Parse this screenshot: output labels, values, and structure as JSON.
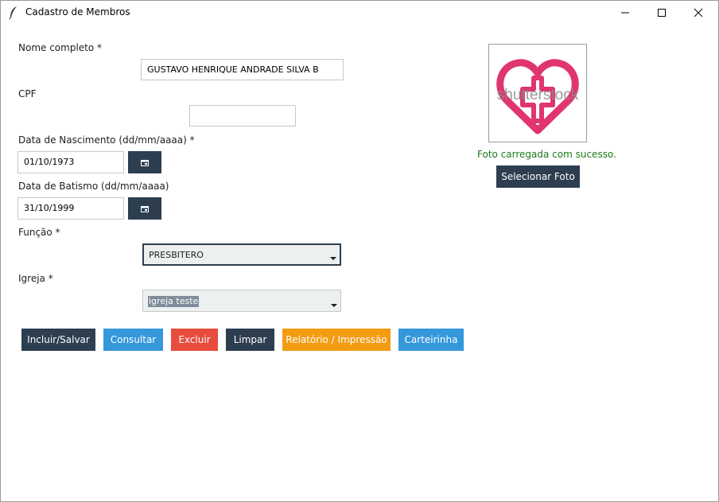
{
  "window": {
    "title": "Cadastro de Membros",
    "icon": "feather-icon",
    "controls": [
      "minimize-icon",
      "maximize-icon",
      "close-icon"
    ]
  },
  "form": {
    "nome": {
      "label": "Nome completo *",
      "value": "GUSTAVO HENRIQUE ANDRADE SILVA B"
    },
    "cpf": {
      "label": "CPF",
      "value": ""
    },
    "nascimento": {
      "label": "Data de Nascimento (dd/mm/aaaa) *",
      "value": "01/10/1973",
      "button_icon": "calendar-icon"
    },
    "batismo": {
      "label": "Data de Batismo (dd/mm/aaaa)",
      "value": "31/10/1999",
      "button_icon": "calendar-icon"
    },
    "funcao": {
      "label": "Função *",
      "value": "PRESBITERO"
    },
    "igreja": {
      "label": "Igreja *",
      "value": "igreja teste"
    }
  },
  "photo": {
    "image_icon": "heart-cross-logo",
    "watermark": "shutterstock",
    "status": "Foto carregada com sucesso.",
    "select_label": "Selecionar Foto"
  },
  "actions": {
    "save": "Incluir/Salvar",
    "query": "Consultar",
    "delete": "Excluir",
    "clear": "Limpar",
    "report": "Relatório / Impressão",
    "card": "Carteirinha"
  },
  "colors": {
    "dark": "#2c3e50",
    "blue": "#3498db",
    "red": "#e74c3c",
    "orange": "#f39c12",
    "logo": "#e0356f",
    "success": "#1a7a1a"
  }
}
